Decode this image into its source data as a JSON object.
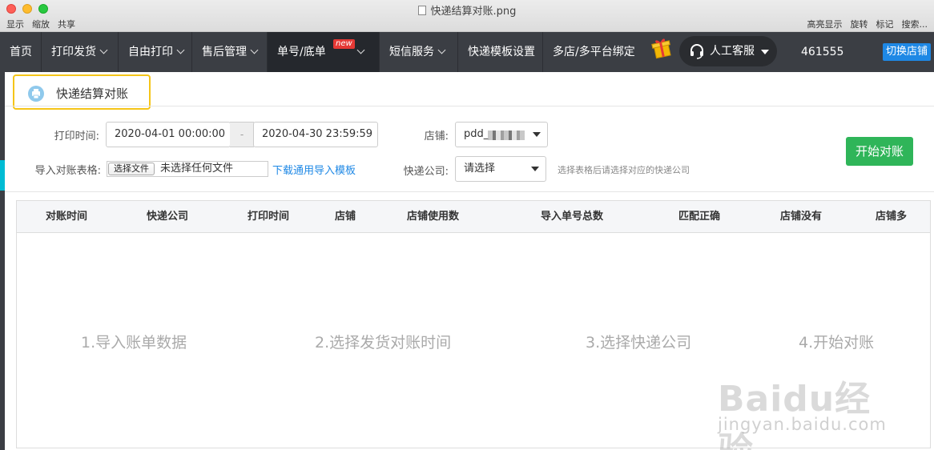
{
  "window": {
    "title": "快递结算对账.png",
    "menu_left": [
      "显示",
      "缩放",
      "共享"
    ],
    "menu_right": [
      "高亮显示",
      "旋转",
      "标记",
      "搜索..."
    ]
  },
  "nav": {
    "items": [
      {
        "label": "首页",
        "has_dropdown": false
      },
      {
        "label": "打印发货",
        "has_dropdown": true
      },
      {
        "label": "自由打印",
        "has_dropdown": true
      },
      {
        "label": "售后管理",
        "has_dropdown": true
      },
      {
        "label": "单号/底单",
        "has_dropdown": true,
        "badge": "new"
      },
      {
        "label": "短信服务",
        "has_dropdown": true
      },
      {
        "label": "快递模板设置",
        "has_dropdown": false
      },
      {
        "label": "多店/多平台绑定",
        "has_dropdown": false
      }
    ],
    "service_label": "人工客服",
    "user_id": "461555",
    "switch_shop": "切换店铺"
  },
  "page": {
    "tab_title": "快递结算对账"
  },
  "filters": {
    "print_time_label": "打印时间:",
    "start_time": "2020-04-01 00:00:00",
    "date_separator": "-",
    "end_time": "2020-04-30 23:59:59",
    "shop_label": "店铺:",
    "shop_value": "pdd_",
    "import_label": "导入对账表格:",
    "file_button": "选择文件",
    "file_status": "未选择任何文件",
    "template_link": "下载通用导入模板",
    "courier_label": "快递公司:",
    "courier_value": "请选择",
    "hint": "选择表格后请选择对应的快递公司",
    "start_button": "开始对账"
  },
  "table": {
    "columns": [
      "对账时间",
      "快递公司",
      "打印时间",
      "店铺",
      "店铺使用数",
      "导入单号总数",
      "匹配正确",
      "店铺没有",
      "店铺多"
    ],
    "steps": [
      "1.导入账单数据",
      "2.选择发货对账时间",
      "3.选择快递公司",
      "4.开始对账"
    ]
  },
  "watermark": {
    "brand": "Baidu经验",
    "sub": "jingyan.baidu.com"
  },
  "colors": {
    "nav_bg": "#3b3e44",
    "accent_yellow": "#f5c518",
    "link_blue": "#1e88e5",
    "start_green": "#2fb559",
    "badge_red": "#e53935"
  }
}
